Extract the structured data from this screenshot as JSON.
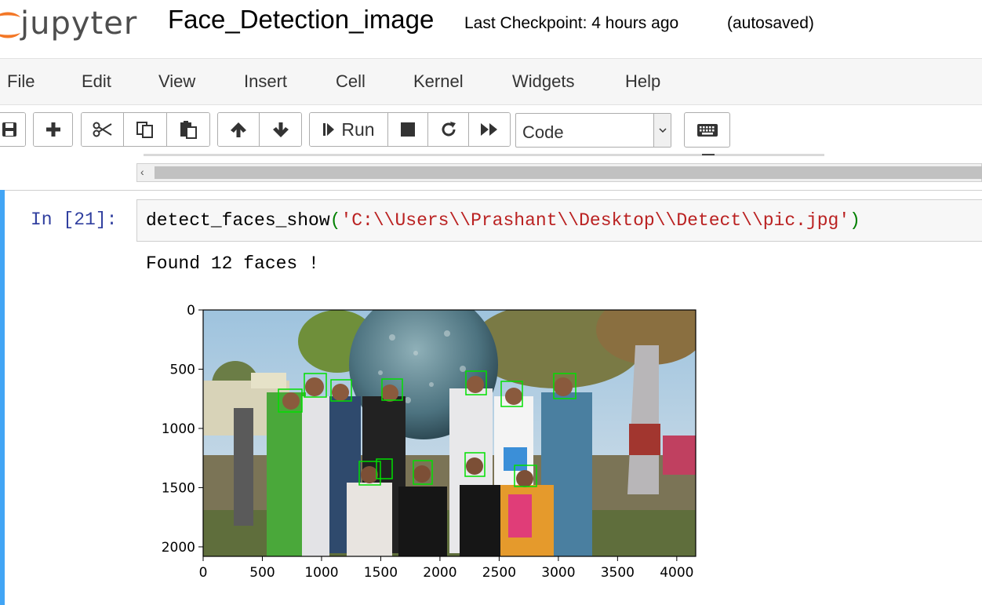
{
  "header": {
    "logo_text": "jupyter",
    "notebook_title": "Face_Detection_image",
    "checkpoint": "Last Checkpoint: 4 hours ago",
    "autosave_status": "(autosaved)"
  },
  "menu": {
    "items": [
      "File",
      "Edit",
      "View",
      "Insert",
      "Cell",
      "Kernel",
      "Widgets",
      "Help"
    ]
  },
  "toolbar": {
    "run_label": "Run",
    "cell_type": "Code",
    "icons": [
      "save-icon",
      "plus-icon",
      "cut-icon",
      "copy-icon",
      "paste-icon",
      "arrow-up-icon",
      "arrow-down-icon",
      "step-forward-icon",
      "stop-icon",
      "restart-icon",
      "fast-forward-icon",
      "keyboard-icon"
    ]
  },
  "cell": {
    "prompt": "In [21]:",
    "code_func": "detect_faces_show",
    "code_open": "(",
    "code_string": "'C:\\\\Users\\\\Prashant\\\\Desktop\\\\Detect\\\\pic.jpg'",
    "code_close": ")",
    "output_text": "Found 12 faces !"
  },
  "plot": {
    "x_ticks": [
      "0",
      "500",
      "1000",
      "1500",
      "2000",
      "2500",
      "3000",
      "3500",
      "4000"
    ],
    "y_ticks": [
      "0",
      "500",
      "1000",
      "1500",
      "2000"
    ],
    "image_width": 4160,
    "image_height": 2080,
    "face_count": 12,
    "box_color": "#00e000"
  }
}
